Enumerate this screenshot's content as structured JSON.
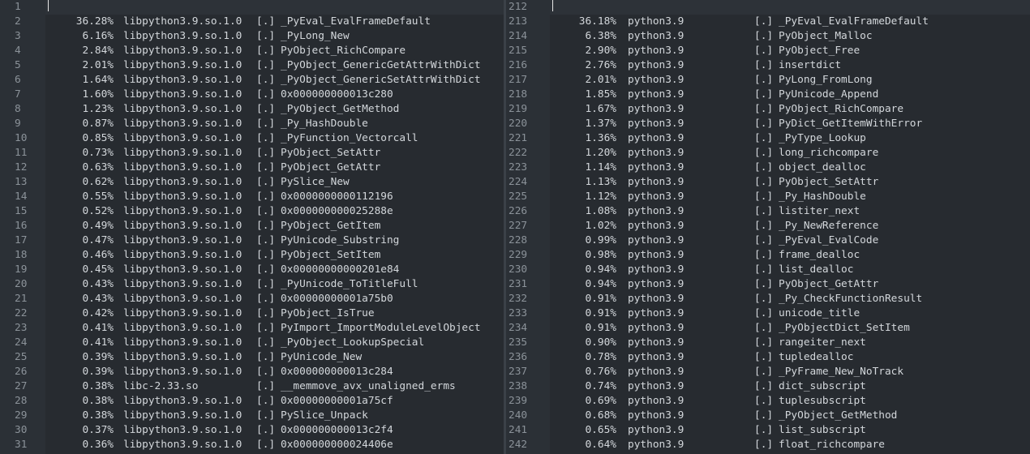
{
  "left": {
    "lines": [
      {
        "num": "1",
        "pct": "",
        "obj": "",
        "tag": "",
        "sym": ""
      },
      {
        "num": "2",
        "pct": "36.28%",
        "obj": "libpython3.9.so.1.0",
        "tag": "[.]",
        "sym": "_PyEval_EvalFrameDefault"
      },
      {
        "num": "3",
        "pct": "6.16%",
        "obj": "libpython3.9.so.1.0",
        "tag": "[.]",
        "sym": "_PyLong_New"
      },
      {
        "num": "4",
        "pct": "2.84%",
        "obj": "libpython3.9.so.1.0",
        "tag": "[.]",
        "sym": "PyObject_RichCompare"
      },
      {
        "num": "5",
        "pct": "2.01%",
        "obj": "libpython3.9.so.1.0",
        "tag": "[.]",
        "sym": "_PyObject_GenericGetAttrWithDict"
      },
      {
        "num": "6",
        "pct": "1.64%",
        "obj": "libpython3.9.so.1.0",
        "tag": "[.]",
        "sym": "_PyObject_GenericSetAttrWithDict"
      },
      {
        "num": "7",
        "pct": "1.60%",
        "obj": "libpython3.9.so.1.0",
        "tag": "[.]",
        "sym": "0x000000000013c280"
      },
      {
        "num": "8",
        "pct": "1.23%",
        "obj": "libpython3.9.so.1.0",
        "tag": "[.]",
        "sym": "_PyObject_GetMethod"
      },
      {
        "num": "9",
        "pct": "0.87%",
        "obj": "libpython3.9.so.1.0",
        "tag": "[.]",
        "sym": "_Py_HashDouble"
      },
      {
        "num": "10",
        "pct": "0.85%",
        "obj": "libpython3.9.so.1.0",
        "tag": "[.]",
        "sym": "_PyFunction_Vectorcall"
      },
      {
        "num": "11",
        "pct": "0.73%",
        "obj": "libpython3.9.so.1.0",
        "tag": "[.]",
        "sym": "PyObject_SetAttr"
      },
      {
        "num": "12",
        "pct": "0.63%",
        "obj": "libpython3.9.so.1.0",
        "tag": "[.]",
        "sym": "PyObject_GetAttr"
      },
      {
        "num": "13",
        "pct": "0.62%",
        "obj": "libpython3.9.so.1.0",
        "tag": "[.]",
        "sym": "PySlice_New"
      },
      {
        "num": "14",
        "pct": "0.55%",
        "obj": "libpython3.9.so.1.0",
        "tag": "[.]",
        "sym": "0x0000000000112196"
      },
      {
        "num": "15",
        "pct": "0.52%",
        "obj": "libpython3.9.so.1.0",
        "tag": "[.]",
        "sym": "0x000000000025288e"
      },
      {
        "num": "16",
        "pct": "0.49%",
        "obj": "libpython3.9.so.1.0",
        "tag": "[.]",
        "sym": "PyObject_GetItem"
      },
      {
        "num": "17",
        "pct": "0.47%",
        "obj": "libpython3.9.so.1.0",
        "tag": "[.]",
        "sym": "PyUnicode_Substring"
      },
      {
        "num": "18",
        "pct": "0.46%",
        "obj": "libpython3.9.so.1.0",
        "tag": "[.]",
        "sym": "PyObject_SetItem"
      },
      {
        "num": "19",
        "pct": "0.45%",
        "obj": "libpython3.9.so.1.0",
        "tag": "[.]",
        "sym": "0x00000000000201e84"
      },
      {
        "num": "20",
        "pct": "0.43%",
        "obj": "libpython3.9.so.1.0",
        "tag": "[.]",
        "sym": "_PyUnicode_ToTitleFull"
      },
      {
        "num": "21",
        "pct": "0.43%",
        "obj": "libpython3.9.so.1.0",
        "tag": "[.]",
        "sym": "0x00000000001a75b0"
      },
      {
        "num": "22",
        "pct": "0.42%",
        "obj": "libpython3.9.so.1.0",
        "tag": "[.]",
        "sym": "PyObject_IsTrue"
      },
      {
        "num": "23",
        "pct": "0.41%",
        "obj": "libpython3.9.so.1.0",
        "tag": "[.]",
        "sym": "PyImport_ImportModuleLevelObject"
      },
      {
        "num": "24",
        "pct": "0.41%",
        "obj": "libpython3.9.so.1.0",
        "tag": "[.]",
        "sym": "_PyObject_LookupSpecial"
      },
      {
        "num": "25",
        "pct": "0.39%",
        "obj": "libpython3.9.so.1.0",
        "tag": "[.]",
        "sym": "PyUnicode_New"
      },
      {
        "num": "26",
        "pct": "0.39%",
        "obj": "libpython3.9.so.1.0",
        "tag": "[.]",
        "sym": "0x000000000013c284"
      },
      {
        "num": "27",
        "pct": "0.38%",
        "obj": "libc-2.33.so",
        "tag": "[.]",
        "sym": "__memmove_avx_unaligned_erms"
      },
      {
        "num": "28",
        "pct": "0.38%",
        "obj": "libpython3.9.so.1.0",
        "tag": "[.]",
        "sym": "0x00000000001a75cf"
      },
      {
        "num": "29",
        "pct": "0.38%",
        "obj": "libpython3.9.so.1.0",
        "tag": "[.]",
        "sym": "PySlice_Unpack"
      },
      {
        "num": "30",
        "pct": "0.37%",
        "obj": "libpython3.9.so.1.0",
        "tag": "[.]",
        "sym": "0x000000000013c2f4"
      },
      {
        "num": "31",
        "pct": "0.36%",
        "obj": "libpython3.9.so.1.0",
        "tag": "[.]",
        "sym": "0x000000000024406e"
      }
    ]
  },
  "right": {
    "lines": [
      {
        "num": "212",
        "pct": "",
        "obj": "",
        "tag": "",
        "sym": ""
      },
      {
        "num": "213",
        "pct": "36.18%",
        "obj": "python3.9",
        "tag": "[.]",
        "sym": "_PyEval_EvalFrameDefault"
      },
      {
        "num": "214",
        "pct": "6.38%",
        "obj": "python3.9",
        "tag": "[.]",
        "sym": "PyObject_Malloc"
      },
      {
        "num": "215",
        "pct": "2.90%",
        "obj": "python3.9",
        "tag": "[.]",
        "sym": "PyObject_Free"
      },
      {
        "num": "216",
        "pct": "2.76%",
        "obj": "python3.9",
        "tag": "[.]",
        "sym": "insertdict"
      },
      {
        "num": "217",
        "pct": "2.01%",
        "obj": "python3.9",
        "tag": "[.]",
        "sym": "PyLong_FromLong"
      },
      {
        "num": "218",
        "pct": "1.85%",
        "obj": "python3.9",
        "tag": "[.]",
        "sym": "PyUnicode_Append"
      },
      {
        "num": "219",
        "pct": "1.67%",
        "obj": "python3.9",
        "tag": "[.]",
        "sym": "PyObject_RichCompare"
      },
      {
        "num": "220",
        "pct": "1.37%",
        "obj": "python3.9",
        "tag": "[.]",
        "sym": "PyDict_GetItemWithError"
      },
      {
        "num": "221",
        "pct": "1.36%",
        "obj": "python3.9",
        "tag": "[.]",
        "sym": "_PyType_Lookup"
      },
      {
        "num": "222",
        "pct": "1.20%",
        "obj": "python3.9",
        "tag": "[.]",
        "sym": "long_richcompare"
      },
      {
        "num": "223",
        "pct": "1.14%",
        "obj": "python3.9",
        "tag": "[.]",
        "sym": "object_dealloc"
      },
      {
        "num": "224",
        "pct": "1.13%",
        "obj": "python3.9",
        "tag": "[.]",
        "sym": "PyObject_SetAttr"
      },
      {
        "num": "225",
        "pct": "1.12%",
        "obj": "python3.9",
        "tag": "[.]",
        "sym": "_Py_HashDouble"
      },
      {
        "num": "226",
        "pct": "1.08%",
        "obj": "python3.9",
        "tag": "[.]",
        "sym": "listiter_next"
      },
      {
        "num": "227",
        "pct": "1.02%",
        "obj": "python3.9",
        "tag": "[.]",
        "sym": "_Py_NewReference"
      },
      {
        "num": "228",
        "pct": "0.99%",
        "obj": "python3.9",
        "tag": "[.]",
        "sym": "_PyEval_EvalCode"
      },
      {
        "num": "229",
        "pct": "0.98%",
        "obj": "python3.9",
        "tag": "[.]",
        "sym": "frame_dealloc"
      },
      {
        "num": "230",
        "pct": "0.94%",
        "obj": "python3.9",
        "tag": "[.]",
        "sym": "list_dealloc"
      },
      {
        "num": "231",
        "pct": "0.94%",
        "obj": "python3.9",
        "tag": "[.]",
        "sym": "PyObject_GetAttr"
      },
      {
        "num": "232",
        "pct": "0.91%",
        "obj": "python3.9",
        "tag": "[.]",
        "sym": "_Py_CheckFunctionResult"
      },
      {
        "num": "233",
        "pct": "0.91%",
        "obj": "python3.9",
        "tag": "[.]",
        "sym": "unicode_title"
      },
      {
        "num": "234",
        "pct": "0.91%",
        "obj": "python3.9",
        "tag": "[.]",
        "sym": "_PyObjectDict_SetItem"
      },
      {
        "num": "235",
        "pct": "0.90%",
        "obj": "python3.9",
        "tag": "[.]",
        "sym": "rangeiter_next"
      },
      {
        "num": "236",
        "pct": "0.78%",
        "obj": "python3.9",
        "tag": "[.]",
        "sym": "tupledealloc"
      },
      {
        "num": "237",
        "pct": "0.76%",
        "obj": "python3.9",
        "tag": "[.]",
        "sym": "_PyFrame_New_NoTrack"
      },
      {
        "num": "238",
        "pct": "0.74%",
        "obj": "python3.9",
        "tag": "[.]",
        "sym": "dict_subscript"
      },
      {
        "num": "239",
        "pct": "0.69%",
        "obj": "python3.9",
        "tag": "[.]",
        "sym": "tuplesubscript"
      },
      {
        "num": "240",
        "pct": "0.68%",
        "obj": "python3.9",
        "tag": "[.]",
        "sym": "_PyObject_GetMethod"
      },
      {
        "num": "241",
        "pct": "0.65%",
        "obj": "python3.9",
        "tag": "[.]",
        "sym": "list_subscript"
      },
      {
        "num": "242",
        "pct": "0.64%",
        "obj": "python3.9",
        "tag": "[.]",
        "sym": "float_richcompare"
      }
    ]
  }
}
